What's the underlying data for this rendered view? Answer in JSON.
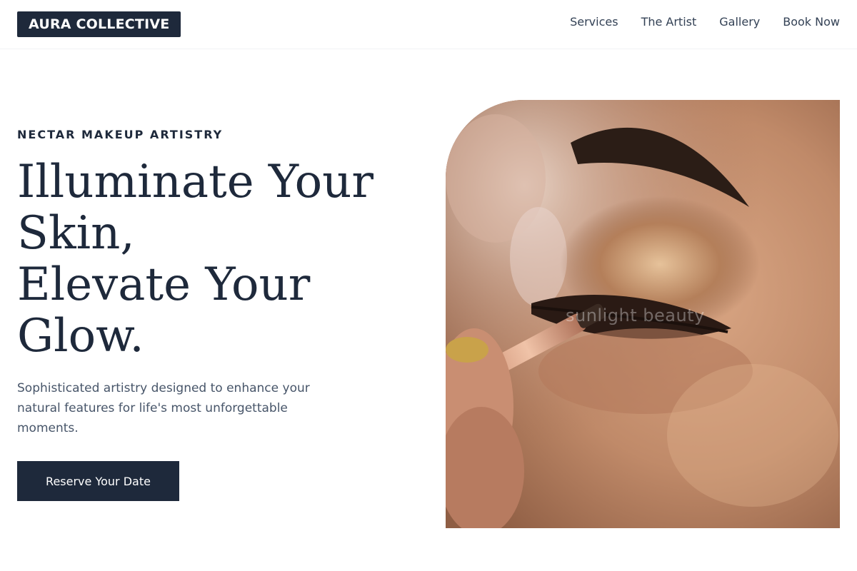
{
  "brand": {
    "logo_text": "AURA COLLECTIVE"
  },
  "nav": {
    "items": [
      {
        "label": "Services"
      },
      {
        "label": "The Artist"
      },
      {
        "label": "Gallery"
      },
      {
        "label": "Book Now"
      }
    ]
  },
  "hero": {
    "eyebrow": "NECTAR MAKEUP ARTISTRY",
    "headline_lines": [
      "Illuminate Your",
      "Skin,",
      "Elevate Your",
      "Glow."
    ],
    "lead": "Sophisticated artistry designed to enhance your natural features for life's most unforgettable moments.",
    "cta_label": "Reserve Your Date",
    "image_watermark": "sunlight beauty"
  },
  "colors": {
    "primary": "#1e293b",
    "body_text": "#475569",
    "background": "#ffffff"
  }
}
